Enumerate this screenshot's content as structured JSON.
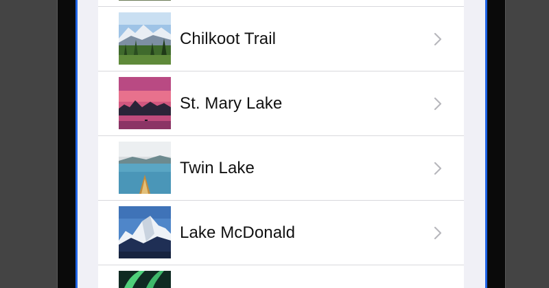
{
  "locations": [
    {
      "name": "Chilkoot Trail"
    },
    {
      "name": "St. Mary Lake"
    },
    {
      "name": "Twin Lake"
    },
    {
      "name": "Lake McDonald"
    }
  ],
  "icons": {
    "row_action": "chevron-right-icon"
  },
  "colors": {
    "accent_ring": "#1e63e6",
    "separator": "#d8d8dc",
    "chevron": "#b7b7bc",
    "text": "#111111"
  }
}
